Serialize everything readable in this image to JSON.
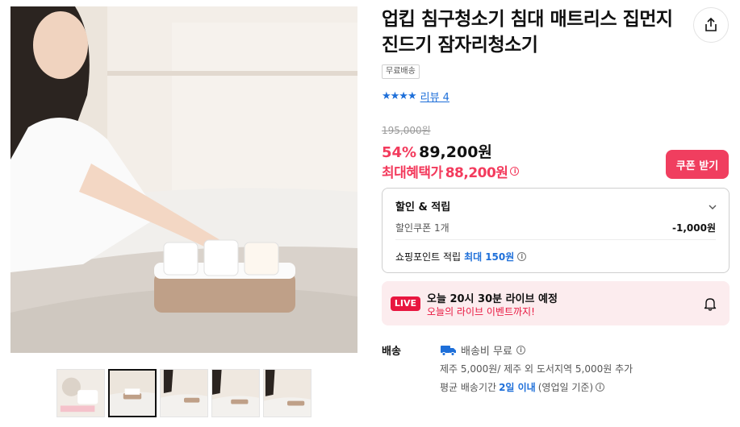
{
  "product": {
    "title": "업킵 침구청소기 침대 매트리스 집먼지진드기 잠자리청소기",
    "badge": "무료배송",
    "rating_stars": "★★★★",
    "review_link": "리뷰 4"
  },
  "price": {
    "original": "195,000원",
    "discount": "54%",
    "current": "89,200원",
    "max_benefit_label": "최대혜택가",
    "max_benefit_value": "88,200원",
    "info_icon": "i"
  },
  "coupon_button": "쿠폰 받기",
  "discount_box": {
    "header": "할인 & 적립",
    "coupon_label": "할인쿠폰 1개",
    "coupon_value": "-1,000원",
    "points_label": "쇼핑포인트 적립",
    "points_max": "최대",
    "points_value": "150원"
  },
  "live": {
    "badge": "LIVE",
    "title": "오늘 20시 30분 라이브 예정",
    "subtitle": "오늘의 라이브 이벤트까지!"
  },
  "shipping": {
    "label": "배송",
    "fee": "배송비 무료",
    "extra": "제주 5,000원/ 제주 외 도서지역 5,000원 추가",
    "period_prefix": "평균 배송기간",
    "period_value": "2일 이내",
    "period_suffix": "(영업일 기준)"
  },
  "colors": {
    "accent_red": "#f03e5f",
    "link_blue": "#1e6fd9",
    "live_bg": "#fcecee"
  },
  "icons": [
    "share-icon",
    "star-icon",
    "info-icon",
    "chevron-down-icon",
    "bell-icon",
    "truck-icon"
  ]
}
